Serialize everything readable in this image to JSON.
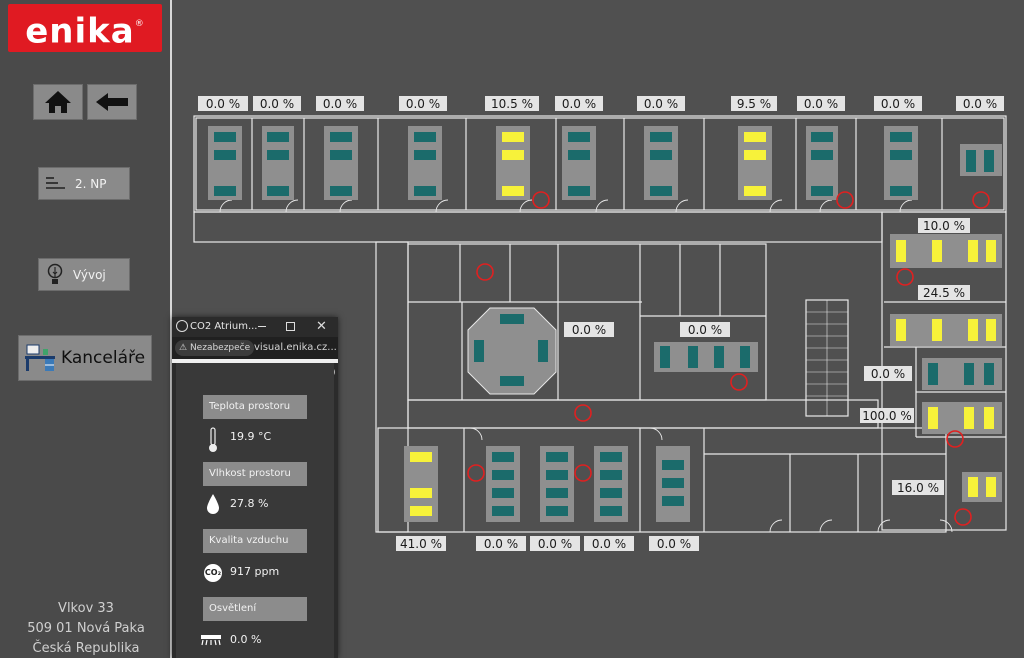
{
  "brand": {
    "logo_text": "enika",
    "logo_mark": "®",
    "color": "#e01a22"
  },
  "sidebar": {
    "home_icon": "home-icon",
    "back_icon": "back-arrow-icon",
    "floor_button": {
      "label": "2. NP",
      "icon": "list-icon"
    },
    "dev_button": {
      "label": "Vývoj",
      "icon": "lightbulb-icon"
    },
    "offices_button": {
      "label": "Kanceláře",
      "icon": "office-desk-icon"
    },
    "address": [
      "Vlkov 33",
      "509 01 Nová Paka",
      "Česká Republika"
    ]
  },
  "floorplan": {
    "top_room_values": [
      "0.0 %",
      "0.0 %",
      "0.0 %",
      "0.0 %",
      "10.5 %",
      "0.0 %",
      "0.0 %",
      "9.5 %",
      "0.0 %",
      "0.0 %",
      "0.0 %"
    ],
    "right_room_values": [
      "10.0 %",
      "24.5 %",
      "0.0 %",
      "100.0 %",
      "16.0 %"
    ],
    "center_room_values": [
      "0.0 %",
      "0.0 %"
    ],
    "bottom_room_values": [
      "41.0 %",
      "0.0 %",
      "0.0 %",
      "0.0 %",
      "0.0 %"
    ],
    "colors": {
      "light_on": "#f7f23a",
      "light_off": "#1b6b6b",
      "info": "#e02020",
      "wall": "#e8e8e8"
    }
  },
  "popup": {
    "title": "CO2 Atrium...",
    "warning": "Nezabezpeče",
    "url": "visual.enika.cz...",
    "sensors": [
      {
        "label": "Teplota prostoru",
        "value": "19.9 °C",
        "icon": "thermometer-icon"
      },
      {
        "label": "Vlhkost prostoru",
        "value": "27.8 %",
        "icon": "droplet-icon"
      },
      {
        "label": "Kvalita vzduchu",
        "value": "917 ppm",
        "icon": "co2-icon"
      },
      {
        "label": "Osvětlení",
        "value": "0.0 %",
        "icon": "light-fixture-icon"
      }
    ]
  }
}
